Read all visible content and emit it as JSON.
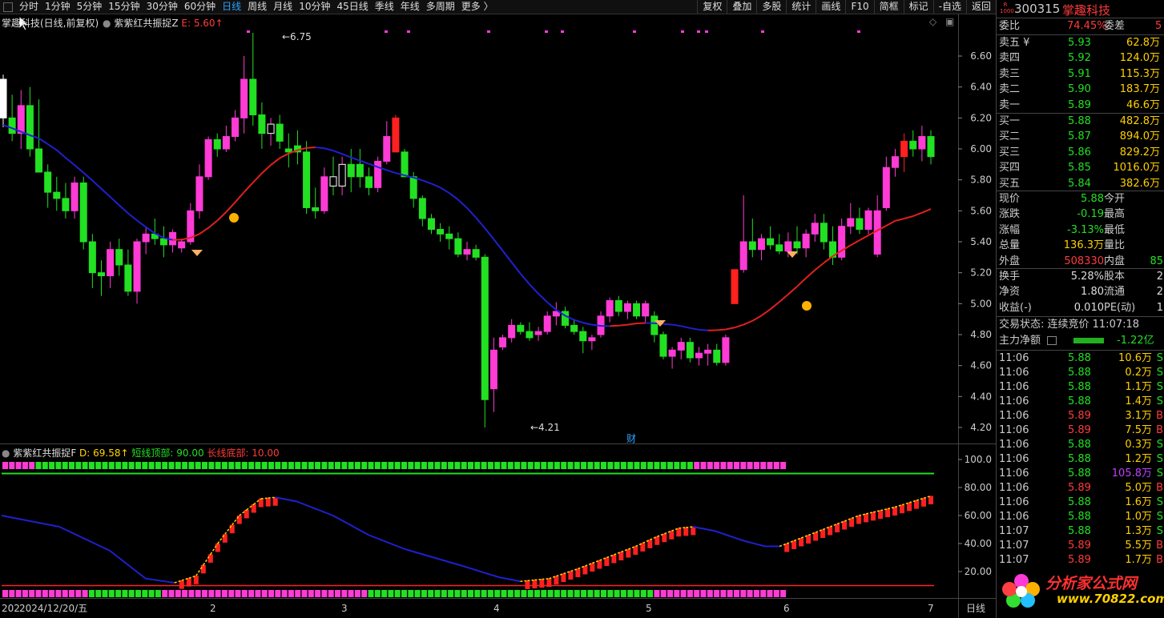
{
  "toolbar": {
    "periods": [
      "分时",
      "1分钟",
      "5分钟",
      "15分钟",
      "30分钟",
      "60分钟",
      "日线",
      "周线",
      "月线",
      "10分钟",
      "45日线",
      "季线",
      "年线",
      "多周期",
      "更多 〉"
    ],
    "active": "日线",
    "right_buttons": [
      "复权",
      "叠加",
      "多股",
      "统计",
      "画线",
      "F10",
      "简框",
      "标记",
      "-自选",
      "返回"
    ]
  },
  "main": {
    "stock_title": "掌趣科技(日线,前复权)",
    "indicator_name": "紫紫红共振捉Z",
    "indicator_value": "E: 5.60↑",
    "high_marker": "6.75",
    "low_marker": "4.21",
    "fin_marker": "财",
    "y_ticks": [
      "6.60",
      "6.40",
      "6.20",
      "6.00",
      "5.80",
      "5.60",
      "5.40",
      "5.20",
      "5.00",
      "4.80",
      "4.60",
      "4.40",
      "4.20"
    ]
  },
  "sub": {
    "indicator_name": "紫紫红共振捉F",
    "d_value": "D: 69.58↑",
    "short_top": "短线顶部: 90.00",
    "long_bottom": "长线底部: 10.00",
    "y_ticks": [
      "100.0",
      "80.00",
      "60.00",
      "40.00",
      "20.00"
    ]
  },
  "xaxis": {
    "labels": [
      "202",
      "2024/12/20/五",
      "2",
      "3",
      "4",
      "5",
      "6",
      "7"
    ],
    "mode": "日线"
  },
  "colors": {
    "up": "#ff3bd6",
    "down": "#22e022",
    "red": "#ff2020",
    "ma_blue": "#2020d0",
    "ma_red": "#e02020"
  },
  "panel": {
    "code": "300315",
    "name": "掌趣科技",
    "badge": "R\n1000",
    "weibi_label": "委比",
    "weibi": "74.45%",
    "weicha_label": "委差",
    "weicha": "5",
    "sells": [
      {
        "label": "卖五 ¥",
        "price": "5.93",
        "vol": "62.8万"
      },
      {
        "label": "卖四",
        "price": "5.92",
        "vol": "124.0万"
      },
      {
        "label": "卖三",
        "price": "5.91",
        "vol": "115.3万"
      },
      {
        "label": "卖二",
        "price": "5.90",
        "vol": "183.7万"
      },
      {
        "label": "卖一",
        "price": "5.89",
        "vol": "46.6万"
      }
    ],
    "buys": [
      {
        "label": "买一",
        "price": "5.88",
        "vol": "482.8万"
      },
      {
        "label": "买二",
        "price": "5.87",
        "vol": "894.0万"
      },
      {
        "label": "买三",
        "price": "5.86",
        "vol": "829.2万"
      },
      {
        "label": "买四",
        "price": "5.85",
        "vol": "1016.0万"
      },
      {
        "label": "买五",
        "price": "5.84",
        "vol": "382.6万"
      }
    ],
    "quote": [
      {
        "l1": "现价",
        "v1": "5.88",
        "l2": "今开",
        "v2": ""
      },
      {
        "l1": "涨跌",
        "v1": "-0.19",
        "l2": "最高",
        "v2": ""
      },
      {
        "l1": "涨幅",
        "v1": "-3.13%",
        "l2": "最低",
        "v2": ""
      },
      {
        "l1": "总量",
        "v1": "136.3万",
        "l2": "量比",
        "v2": ""
      },
      {
        "l1": "外盘",
        "v1": "508330",
        "l2": "内盘",
        "v2": "85"
      }
    ],
    "quote2": [
      {
        "l1": "换手",
        "v1": "5.28%",
        "l2": "股本",
        "v2": "2"
      },
      {
        "l1": "净资",
        "v1": "1.80",
        "l2": "流通",
        "v2": "2"
      },
      {
        "l1": "收益(-)",
        "v1": "0.010",
        "l2": "PE(动)",
        "v2": "1"
      }
    ],
    "trade_status": "交易状态: 连续竞价 11:07:18",
    "main_net_label": "主力净额",
    "main_net": "-1.22亿",
    "ticks": [
      {
        "t": "11:06",
        "p": "5.88",
        "v": "10.6万",
        "s": "S"
      },
      {
        "t": "11:06",
        "p": "5.88",
        "v": "0.2万",
        "s": "S"
      },
      {
        "t": "11:06",
        "p": "5.88",
        "v": "1.1万",
        "s": "S"
      },
      {
        "t": "11:06",
        "p": "5.88",
        "v": "1.4万",
        "s": "S"
      },
      {
        "t": "11:06",
        "p": "5.89",
        "v": "3.1万",
        "s": "B"
      },
      {
        "t": "11:06",
        "p": "5.89",
        "v": "7.5万",
        "s": "B"
      },
      {
        "t": "11:06",
        "p": "5.88",
        "v": "0.3万",
        "s": "S"
      },
      {
        "t": "11:06",
        "p": "5.88",
        "v": "1.2万",
        "s": "S"
      },
      {
        "t": "11:06",
        "p": "5.88",
        "v": "105.8万",
        "s": "S"
      },
      {
        "t": "11:06",
        "p": "5.89",
        "v": "5.0万",
        "s": "B"
      },
      {
        "t": "11:06",
        "p": "5.88",
        "v": "1.6万",
        "s": "S"
      },
      {
        "t": "11:06",
        "p": "5.88",
        "v": "1.0万",
        "s": "S"
      },
      {
        "t": "11:07",
        "p": "5.88",
        "v": "1.3万",
        "s": "S"
      },
      {
        "t": "11:07",
        "p": "5.89",
        "v": "5.5万",
        "s": "B"
      },
      {
        "t": "11:07",
        "p": "5.89",
        "v": "1.7万",
        "s": "B"
      }
    ],
    "logo_text": "分析家公式网",
    "logo_url": "www.70822.com"
  },
  "chart_data": {
    "type": "candlestick",
    "title": "掌趣科技(日线,前复权)",
    "ylim": [
      4.15,
      6.75
    ],
    "candles": [
      [
        6.45,
        6.48,
        6.14,
        6.2
      ],
      [
        6.2,
        6.35,
        6.05,
        6.1
      ],
      [
        6.1,
        6.38,
        6.0,
        6.28
      ],
      [
        6.28,
        6.4,
        5.95,
        6.0
      ],
      [
        6.0,
        6.32,
        5.85,
        5.85
      ],
      [
        5.85,
        5.9,
        5.62,
        5.72
      ],
      [
        5.72,
        5.82,
        5.6,
        5.68
      ],
      [
        5.68,
        5.78,
        5.55,
        5.6
      ],
      [
        5.6,
        5.82,
        5.55,
        5.78
      ],
      [
        5.78,
        5.82,
        5.35,
        5.4
      ],
      [
        5.4,
        5.45,
        5.1,
        5.2
      ],
      [
        5.2,
        5.28,
        5.05,
        5.18
      ],
      [
        5.18,
        5.4,
        5.1,
        5.35
      ],
      [
        5.35,
        5.42,
        5.18,
        5.25
      ],
      [
        5.25,
        5.35,
        5.05,
        5.08
      ],
      [
        5.08,
        5.42,
        5.0,
        5.4
      ],
      [
        5.4,
        5.5,
        5.32,
        5.45
      ],
      [
        5.45,
        5.55,
        5.38,
        5.42
      ],
      [
        5.42,
        5.5,
        5.3,
        5.38
      ],
      [
        5.38,
        5.48,
        5.33,
        5.46
      ],
      [
        5.36,
        5.42,
        5.33,
        5.4
      ],
      [
        5.4,
        5.65,
        5.38,
        5.6
      ],
      [
        5.6,
        5.9,
        5.55,
        5.82
      ],
      [
        5.82,
        6.08,
        5.8,
        6.06
      ],
      [
        6.06,
        6.1,
        5.95,
        6.0
      ],
      [
        6.0,
        6.15,
        5.98,
        6.08
      ],
      [
        6.08,
        6.25,
        6.05,
        6.2
      ],
      [
        6.2,
        6.6,
        6.1,
        6.45
      ],
      [
        6.45,
        6.75,
        6.15,
        6.22
      ],
      [
        6.22,
        6.3,
        6.0,
        6.1
      ],
      [
        6.1,
        6.2,
        6.02,
        6.16
      ],
      [
        6.16,
        6.22,
        6.0,
        6.05
      ],
      [
        6.0,
        6.1,
        5.88,
        5.98
      ],
      [
        6.02,
        6.12,
        5.9,
        5.98
      ],
      [
        5.98,
        6.05,
        5.58,
        5.62
      ],
      [
        5.62,
        5.75,
        5.55,
        5.6
      ],
      [
        5.6,
        5.88,
        5.58,
        5.82
      ],
      [
        5.82,
        5.95,
        5.7,
        5.76
      ],
      [
        5.76,
        5.95,
        5.7,
        5.9
      ],
      [
        5.9,
        6.0,
        5.72,
        5.82
      ],
      [
        5.9,
        6.0,
        5.75,
        5.82
      ],
      [
        5.82,
        5.88,
        5.7,
        5.75
      ],
      [
        5.75,
        5.95,
        5.72,
        5.92
      ],
      [
        5.92,
        6.18,
        5.9,
        6.08
      ],
      [
        6.2,
        6.22,
        5.98,
        5.98
      ],
      [
        5.98,
        6.0,
        5.82,
        5.82
      ],
      [
        5.82,
        5.85,
        5.62,
        5.68
      ],
      [
        5.68,
        5.7,
        5.5,
        5.55
      ],
      [
        5.55,
        5.58,
        5.45,
        5.48
      ],
      [
        5.48,
        5.52,
        5.4,
        5.45
      ],
      [
        5.45,
        5.5,
        5.35,
        5.42
      ],
      [
        5.42,
        5.46,
        5.3,
        5.32
      ],
      [
        5.32,
        5.4,
        5.28,
        5.35
      ],
      [
        5.35,
        5.38,
        5.28,
        5.3
      ],
      [
        5.3,
        5.32,
        4.2,
        4.38
      ],
      [
        4.45,
        4.78,
        4.3,
        4.7
      ],
      [
        4.72,
        4.8,
        4.7,
        4.78
      ],
      [
        4.78,
        4.9,
        4.75,
        4.86
      ],
      [
        4.86,
        4.88,
        4.8,
        4.82
      ],
      [
        4.82,
        4.88,
        4.76,
        4.78
      ],
      [
        4.8,
        4.85,
        4.76,
        4.82
      ],
      [
        4.82,
        4.95,
        4.8,
        4.92
      ],
      [
        4.92,
        5.01,
        4.86,
        4.95
      ],
      [
        4.95,
        4.98,
        4.84,
        4.86
      ],
      [
        4.86,
        4.9,
        4.8,
        4.82
      ],
      [
        4.82,
        4.85,
        4.68,
        4.76
      ],
      [
        4.76,
        4.8,
        4.7,
        4.78
      ],
      [
        4.8,
        4.95,
        4.78,
        4.92
      ],
      [
        4.92,
        5.04,
        4.88,
        5.02
      ],
      [
        5.02,
        5.05,
        4.92,
        4.95
      ],
      [
        4.95,
        5.02,
        4.9,
        5.0
      ],
      [
        5.0,
        5.02,
        4.9,
        4.92
      ],
      [
        4.92,
        5.02,
        4.88,
        5.0
      ],
      [
        4.92,
        4.95,
        4.75,
        4.8
      ],
      [
        4.8,
        4.82,
        4.64,
        4.66
      ],
      [
        4.66,
        4.72,
        4.58,
        4.7
      ],
      [
        4.7,
        4.78,
        4.64,
        4.75
      ],
      [
        4.75,
        4.78,
        4.62,
        4.65
      ],
      [
        4.65,
        4.72,
        4.6,
        4.68
      ],
      [
        4.68,
        4.74,
        4.6,
        4.7
      ],
      [
        4.7,
        4.74,
        4.6,
        4.62
      ],
      [
        4.62,
        4.8,
        4.6,
        4.78
      ],
      [
        5.0,
        5.22,
        5.0,
        5.22
      ],
      [
        5.22,
        5.7,
        5.2,
        5.4
      ],
      [
        5.4,
        5.55,
        5.3,
        5.35
      ],
      [
        5.35,
        5.45,
        5.28,
        5.42
      ],
      [
        5.42,
        5.5,
        5.35,
        5.38
      ],
      [
        5.38,
        5.45,
        5.32,
        5.34
      ],
      [
        5.34,
        5.46,
        5.3,
        5.4
      ],
      [
        5.4,
        5.5,
        5.32,
        5.36
      ],
      [
        5.36,
        5.48,
        5.3,
        5.45
      ],
      [
        5.45,
        5.58,
        5.4,
        5.52
      ],
      [
        5.52,
        5.58,
        5.35,
        5.4
      ],
      [
        5.4,
        5.5,
        5.25,
        5.3
      ],
      [
        5.3,
        5.55,
        5.28,
        5.5
      ],
      [
        5.5,
        5.65,
        5.45,
        5.55
      ],
      [
        5.55,
        5.62,
        5.45,
        5.48
      ],
      [
        5.48,
        5.62,
        5.45,
        5.6
      ],
      [
        5.6,
        5.7,
        5.3,
        5.32
      ],
      [
        5.62,
        5.95,
        5.6,
        5.88
      ],
      [
        5.88,
        6.0,
        5.82,
        5.95
      ],
      [
        5.95,
        6.1,
        5.85,
        6.05
      ],
      [
        6.05,
        6.12,
        5.95,
        6.0
      ],
      [
        6.0,
        6.15,
        5.92,
        6.08
      ],
      [
        6.08,
        6.12,
        5.9,
        5.95
      ]
    ]
  }
}
